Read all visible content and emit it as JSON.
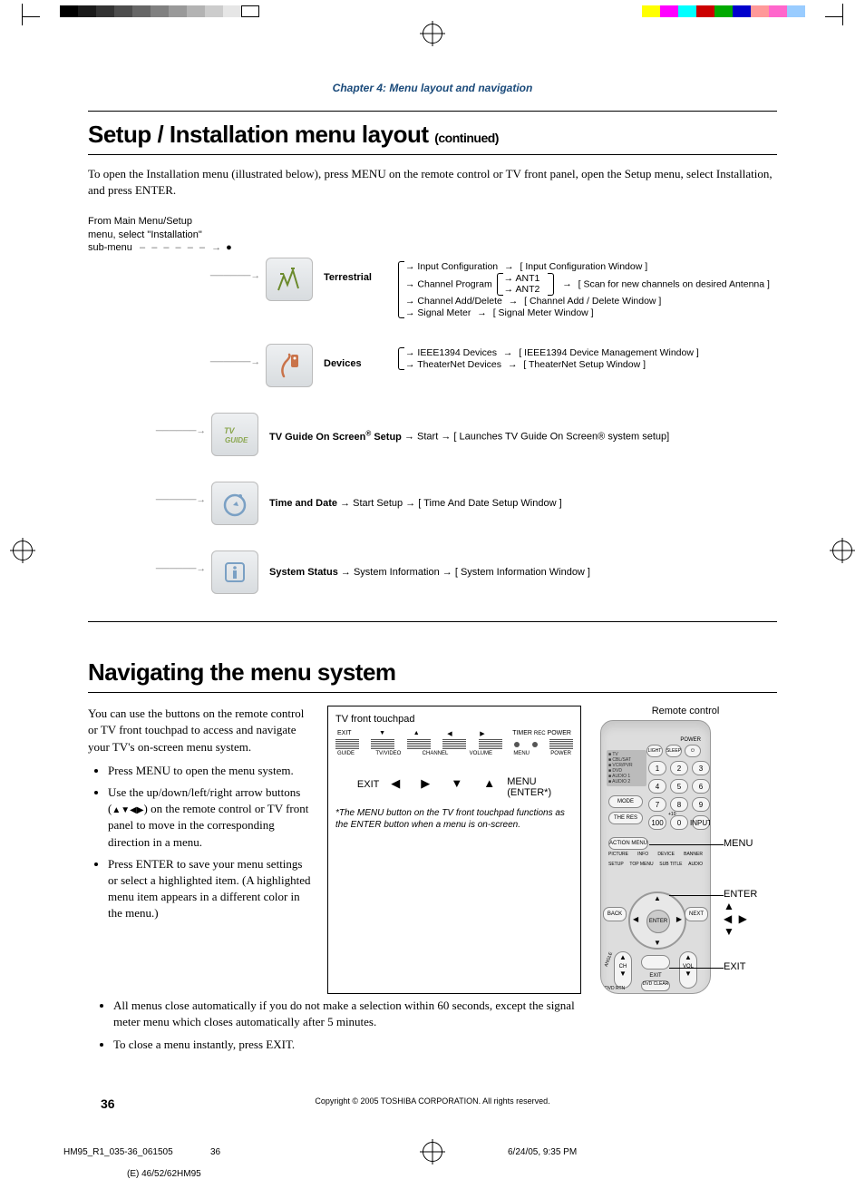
{
  "header": {
    "chapter": "Chapter 4: Menu layout and navigation"
  },
  "section1": {
    "title": "Setup / Installation menu layout",
    "continued": "(continued)",
    "intro": "To open the Installation menu (illustrated below), press MENU on the remote control or TV front panel, open the Setup menu, select Installation, and press ENTER."
  },
  "diagram": {
    "from_main_l1": "From Main Menu/Setup",
    "from_main_l2": "menu, select \"Installation\"",
    "from_main_l3": "sub-menu",
    "terrestrial": {
      "label": "Terrestrial",
      "line1a": "Input Configuration",
      "line1b": "[ Input Configuration Window ]",
      "line2a": "Channel Program",
      "line2_ant1": "ANT1",
      "line2_ant2": "ANT2",
      "line2b": "[ Scan for new channels on desired Antenna ]",
      "line3a": "Channel Add/Delete",
      "line3b": "[ Channel Add / Delete Window ]",
      "line4a": "Signal Meter",
      "line4b": "[ Signal Meter Window ]"
    },
    "devices": {
      "label": "Devices",
      "line1a": "IEEE1394 Devices",
      "line1b": "[ IEEE1394 Device Management Window ]",
      "line2a": "TheaterNet Devices",
      "line2b": "[ TheaterNet Setup Window ]"
    },
    "tvguide": {
      "label_pre": "TV Guide On Screen",
      "label_post": " Setup",
      "start": "Start",
      "result": "[ Launches TV Guide On Screen® system setup]"
    },
    "timedate": {
      "label": "Time and Date",
      "start": "Start Setup",
      "result": "[ Time And Date Setup Window ]"
    },
    "status": {
      "label": "System Status",
      "mid": "System Information",
      "result": "[ System Information Window ]"
    }
  },
  "section2": {
    "title": "Navigating the menu system",
    "intro": "You can use the buttons on the remote control or TV front touchpad to access and navigate your TV's on-screen menu system.",
    "bullet1": "Press MENU to open the menu system.",
    "bullet2_pre": "Use the up/down/left/right arrow buttons (",
    "bullet2_post": ") on the remote control or TV front panel to move in the corresponding direction in a menu.",
    "bullet3": "Press ENTER to save your menu settings or select a highlighted item. (A highlighted menu item appears in a different color in the menu.)",
    "bullet4": "All menus close automatically if you do not make a selection within 60 seconds, except the signal meter menu which closes automatically after 5 minutes.",
    "bullet5": "To close a menu instantly, press EXIT."
  },
  "touchpad": {
    "title": "TV front touchpad",
    "top_exit": "EXIT",
    "top_timer": "TIMER",
    "top_rec": "REC",
    "top_power": "POWER",
    "lbl_guide": "GUIDE",
    "lbl_tvvideo": "TV/VIDEO",
    "lbl_channel": "CHANNEL",
    "lbl_volume": "VOLUME",
    "lbl_menu": "MENU",
    "lbl_power": "POWER",
    "exit": "EXIT",
    "menu": "MENU",
    "enter_note": "(ENTER*)",
    "note": "*The MENU button on the TV front touchpad functions as the ENTER button when a menu is on-screen."
  },
  "remote": {
    "title": "Remote control",
    "callout_menu": "MENU",
    "callout_enter": "ENTER",
    "callout_exit": "EXIT",
    "btn_light": "LIGHT",
    "btn_sleep": "SLEEP",
    "btn_power": "⏻",
    "btn_mode": "MODE",
    "btn_theres": "THE RES",
    "btn_100": "100",
    "btn_input": "INPUT",
    "btn_action": "ACTION",
    "btn_menu": "MENU",
    "btn_enter": "ENTER",
    "btn_back": "BACK",
    "btn_next": "NEXT",
    "btn_exit": "EXIT",
    "btn_ch": "CH",
    "btn_vol": "VOL",
    "lbl_info": "INFO",
    "lbl_device": "DEVICE",
    "lbl_picture": "PICTURE",
    "lbl_setup": "SETUP",
    "lbl_topmenu": "TOP MENU",
    "lbl_subtitle": "SUB TITLE",
    "lbl_audio": "AUDIO",
    "lbl_angle": "ANGLE",
    "lbl_banner": "BANNER",
    "lbl_dvdclear": "DVD CLEAR",
    "lbl_dvdrtn": "DVD RTN",
    "lbl_plus10": "+10",
    "side_tv": "TV",
    "side_cblsat": "CBL/SAT",
    "side_vcrpvr": "VCR/PVR",
    "side_dvd": "DVD",
    "side_audio1": "AUDIO 1",
    "side_audio2": "AUDIO 2",
    "lbl_powertop": "POWER"
  },
  "footer": {
    "copyright": "Copyright © 2005 TOSHIBA CORPORATION. All rights reserved.",
    "page": "36",
    "filecode": "HM95_R1_035-36_061505",
    "filepage": "36",
    "filedate": "6/24/05, 9:35 PM",
    "model": "(E) 46/52/62HM95"
  }
}
